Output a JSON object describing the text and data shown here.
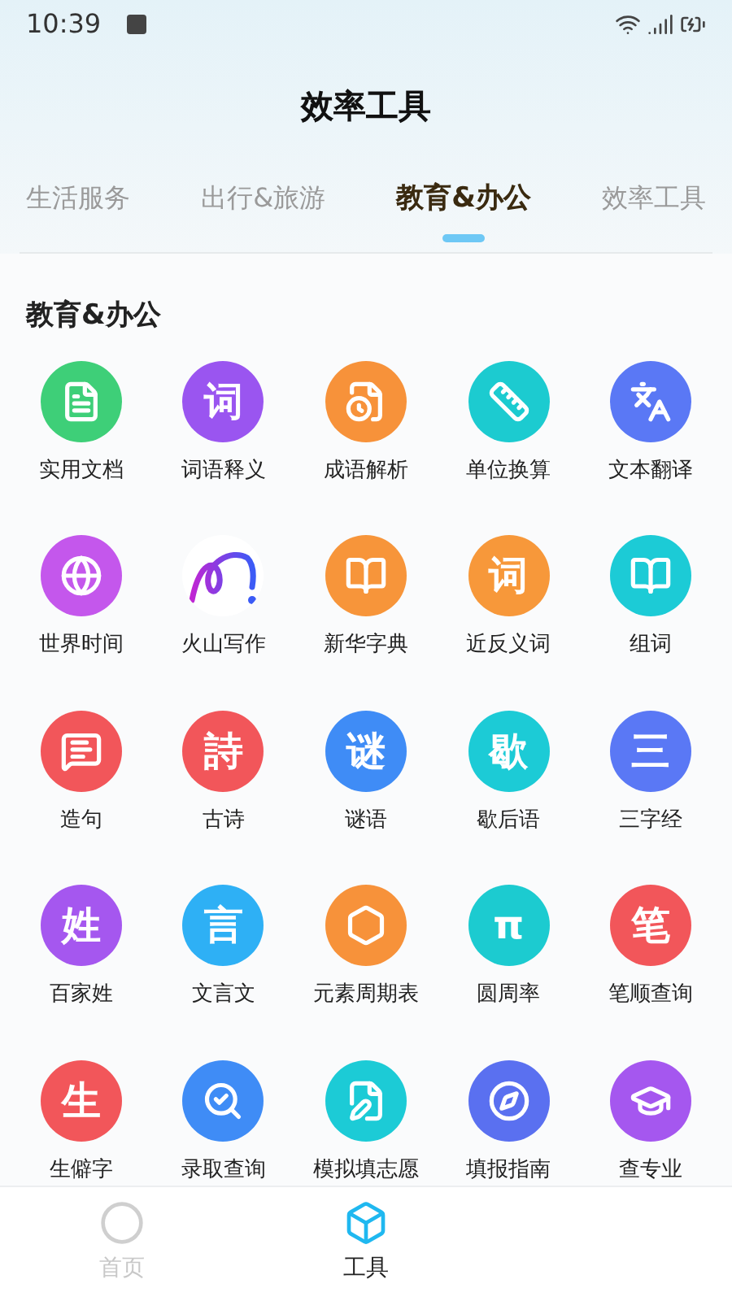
{
  "status_bar": {
    "time": "10:39"
  },
  "title": "效率工具",
  "tabs": [
    {
      "label": "生活服务",
      "selected": false
    },
    {
      "label": "出行&旅游",
      "selected": false
    },
    {
      "label": "教育&办公",
      "selected": true
    },
    {
      "label": "效率工具",
      "selected": false
    }
  ],
  "section": {
    "title": "教育&办公"
  },
  "tools": [
    {
      "label": "实用文档",
      "kind": "doc",
      "color": "#3ecf78"
    },
    {
      "label": "词语释义",
      "kind": "glyph",
      "glyph": "词",
      "color": "#9a55f0"
    },
    {
      "label": "成语解析",
      "kind": "clockdoc",
      "color": "#f7923a"
    },
    {
      "label": "单位换算",
      "kind": "ruler",
      "color": "#1ccbd0"
    },
    {
      "label": "文本翻译",
      "kind": "translate",
      "color": "#5a78f5"
    },
    {
      "label": "世界时间",
      "kind": "globe",
      "color": "#c457ec"
    },
    {
      "label": "火山写作",
      "kind": "logo",
      "color": "#ffffff"
    },
    {
      "label": "新华字典",
      "kind": "book",
      "color": "#f7953a"
    },
    {
      "label": "近反义词",
      "kind": "glyph",
      "glyph": "词",
      "color": "#f7983a"
    },
    {
      "label": "组词",
      "kind": "az",
      "color": "#1ccbd6"
    },
    {
      "label": "造句",
      "kind": "chat",
      "color": "#f2565a"
    },
    {
      "label": "古诗",
      "kind": "glyph",
      "glyph": "詩",
      "color": "#f2565a"
    },
    {
      "label": "谜语",
      "kind": "glyph",
      "glyph": "谜",
      "color": "#3f8cf6"
    },
    {
      "label": "歇后语",
      "kind": "glyph",
      "glyph": "歇",
      "color": "#1ccbd6"
    },
    {
      "label": "三字经",
      "kind": "glyph",
      "glyph": "三",
      "color": "#5a78f5"
    },
    {
      "label": "百家姓",
      "kind": "glyph",
      "glyph": "姓",
      "color": "#a557ef"
    },
    {
      "label": "文言文",
      "kind": "glyph",
      "glyph": "言",
      "color": "#2eb0f5"
    },
    {
      "label": "元素周期表",
      "kind": "hex",
      "color": "#f7923a"
    },
    {
      "label": "圆周率",
      "kind": "glyph",
      "glyph": "π",
      "color": "#1ccbd0"
    },
    {
      "label": "笔顺查询",
      "kind": "glyph",
      "glyph": "笔",
      "color": "#f2565a"
    },
    {
      "label": "生僻字",
      "kind": "glyph",
      "glyph": "生",
      "color": "#f2565a"
    },
    {
      "label": "录取查询",
      "kind": "search",
      "color": "#3f8cf6"
    },
    {
      "label": "模拟填志愿",
      "kind": "form",
      "color": "#1ccbd6"
    },
    {
      "label": "填报指南",
      "kind": "compass",
      "color": "#5a70f0"
    },
    {
      "label": "查专业",
      "kind": "cap",
      "color": "#a557ef"
    }
  ],
  "nav": [
    {
      "label": "首页",
      "selected": false
    },
    {
      "label": "工具",
      "selected": true
    }
  ]
}
